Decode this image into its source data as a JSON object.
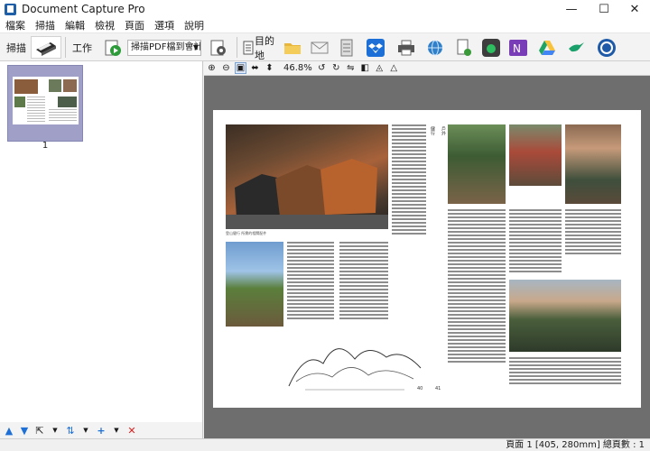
{
  "window": {
    "title": "Document Capture Pro",
    "minimize": "—",
    "maximize": "☐",
    "close": "✕"
  },
  "menu": [
    "檔案",
    "掃描",
    "編輯",
    "檢視",
    "頁面",
    "選項",
    "說明"
  ],
  "toolbar": {
    "scan_label": "掃描",
    "job_label": "工作",
    "job_select": "掃描PDF檔到會計",
    "destination_label": "目的地"
  },
  "destinations": [
    "folder",
    "email",
    "printer-device",
    "dropbox",
    "printer",
    "web",
    "document",
    "evernote",
    "onenote",
    "google-drive",
    "hummingbird",
    "other"
  ],
  "thumbnails": [
    {
      "number": "1"
    }
  ],
  "view": {
    "zoom": "46.8%"
  },
  "status": {
    "text": "頁面 1 [405, 280mm]  總頁數 : 1"
  },
  "document": {
    "caption_left": "登山健行 所需的相關配件",
    "page_footer_left": "40",
    "page_footer_right": "41",
    "side_title_left": "健行",
    "side_title_right": "戶外"
  }
}
